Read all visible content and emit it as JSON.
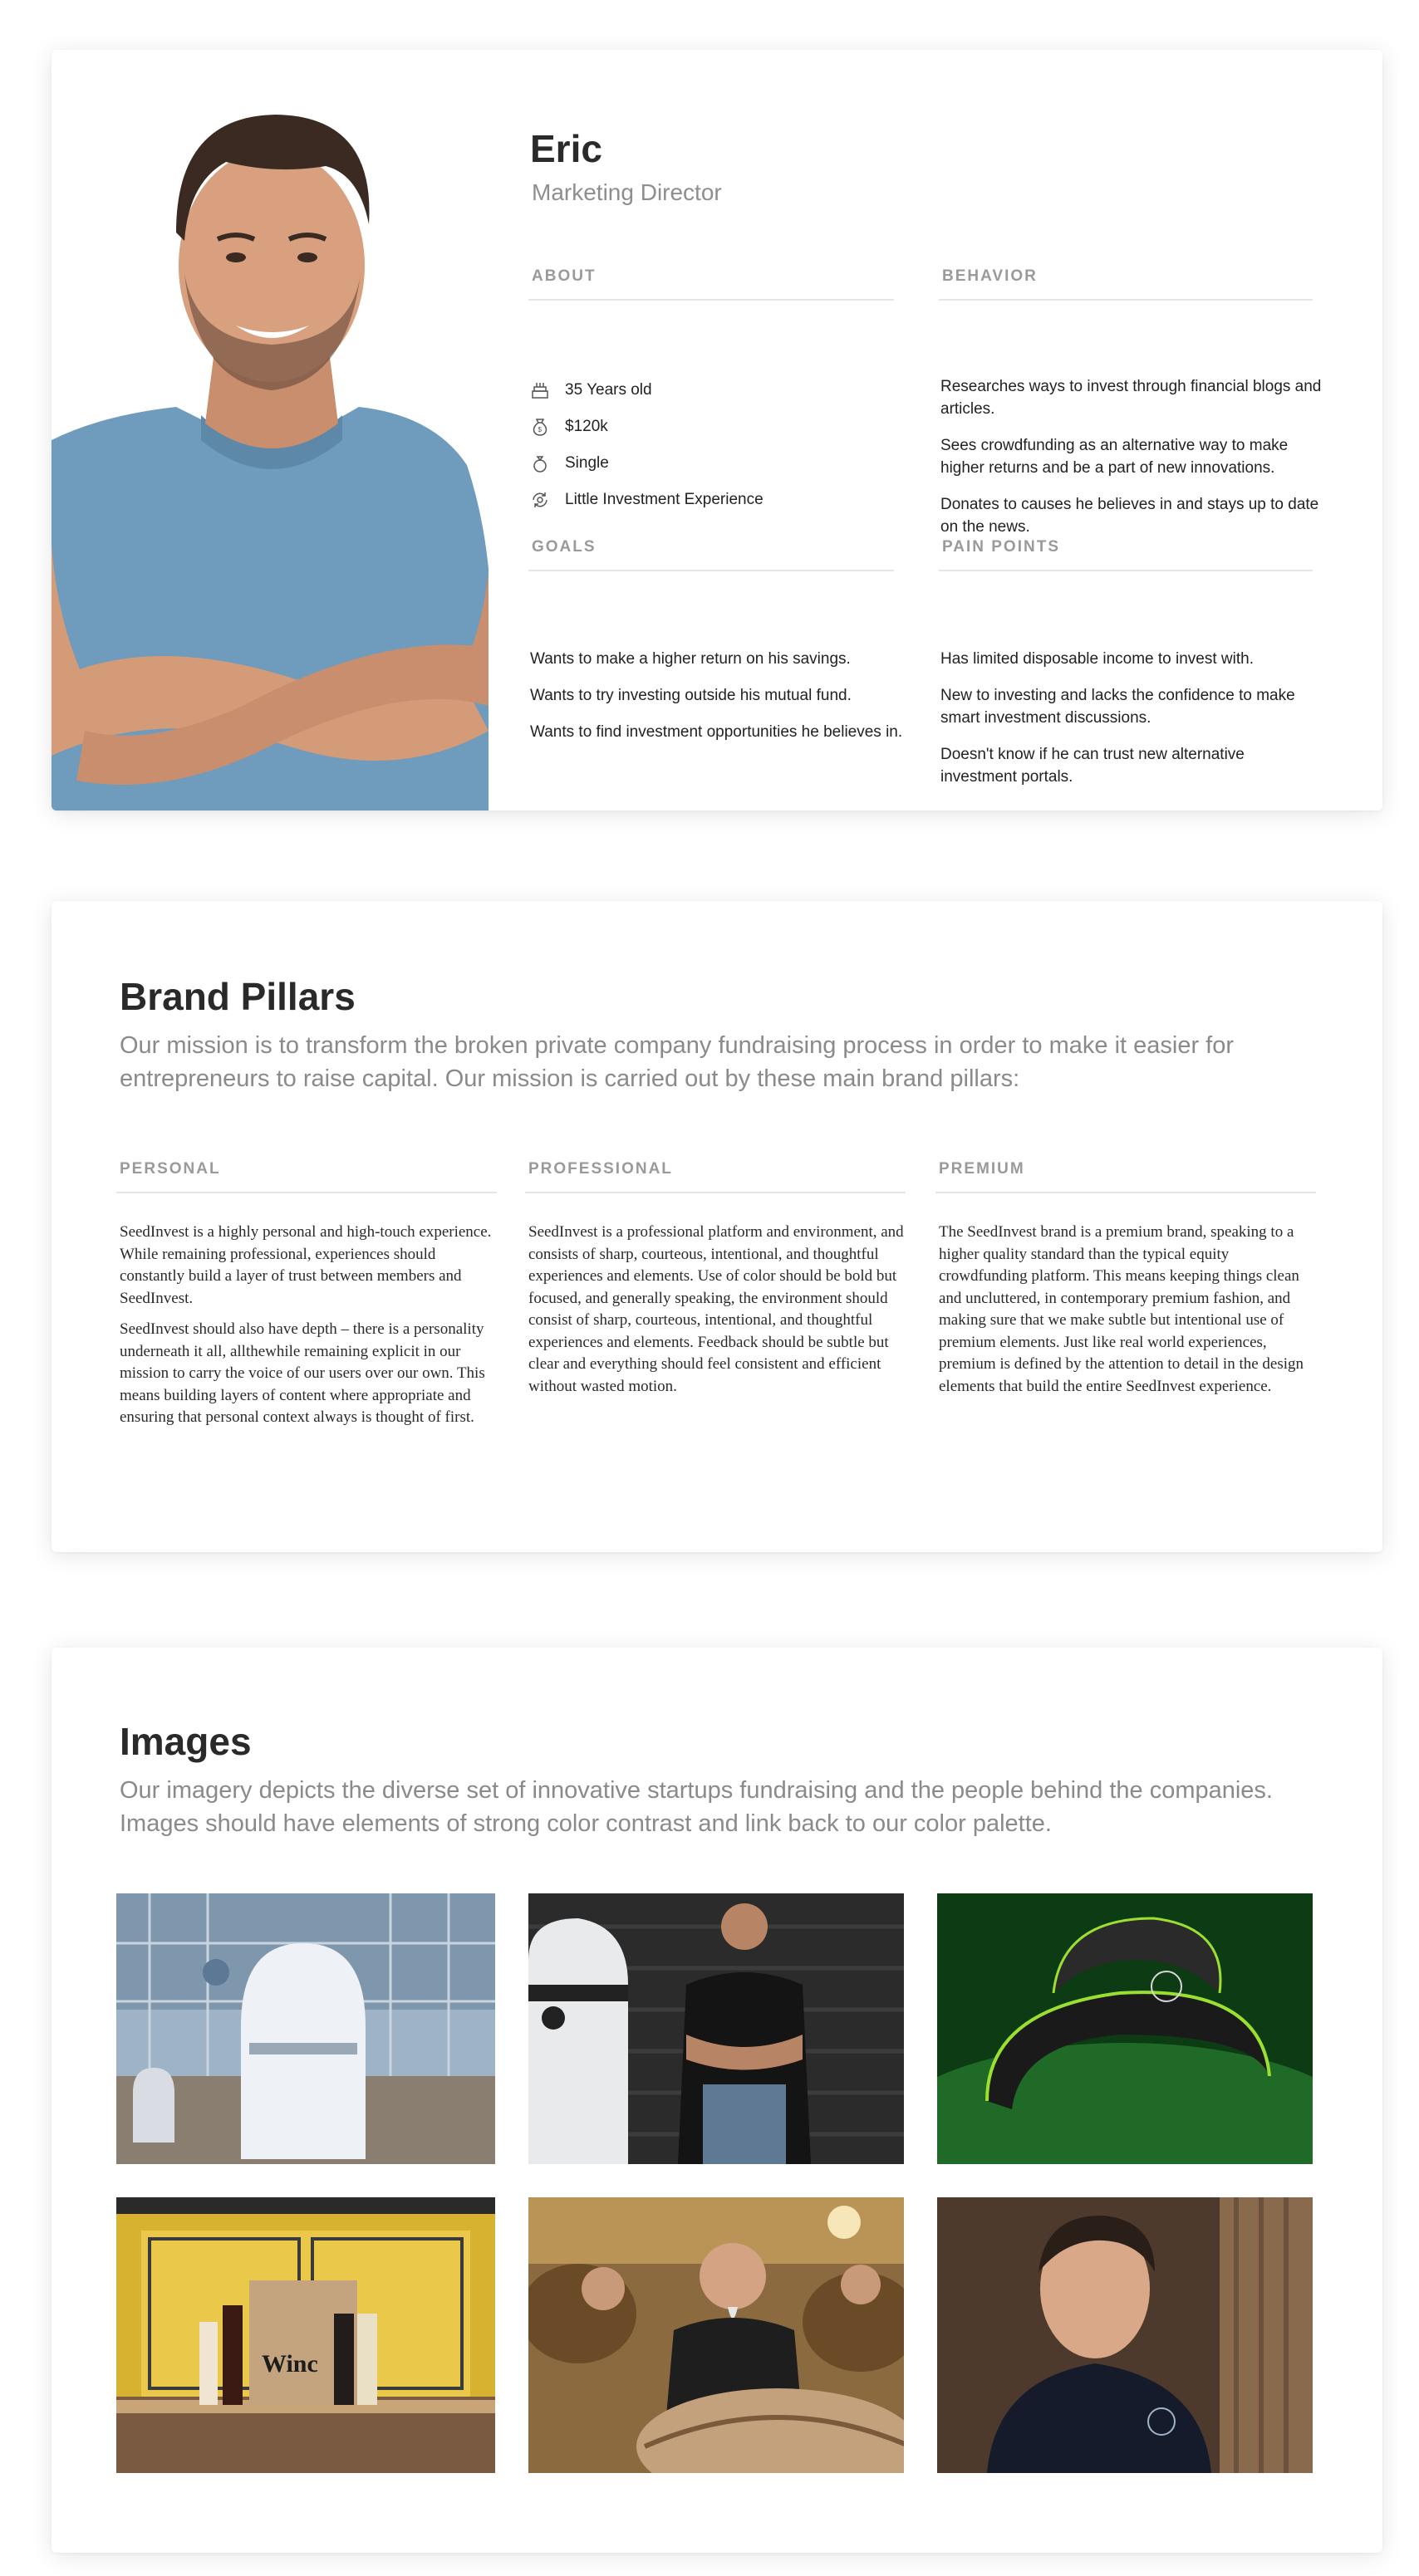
{
  "persona": {
    "name": "Eric",
    "role": "Marketing Director",
    "about": {
      "label": "ABOUT",
      "items": [
        {
          "icon": "birthday-cake-icon",
          "text": "35 Years old"
        },
        {
          "icon": "money-bag-icon",
          "text": "$120k"
        },
        {
          "icon": "ring-icon",
          "text": "Single"
        },
        {
          "icon": "investment-cycle-icon",
          "text": "Little Investment Experience"
        }
      ]
    },
    "behavior": {
      "label": "BEHAVIOR",
      "items": [
        "Researches ways to invest through financial blogs and articles.",
        "Sees crowdfunding as an alternative way to make higher returns and be a part of new innovations.",
        "Donates to causes he believes in and stays up to date on the news."
      ]
    },
    "goals": {
      "label": "GOALS",
      "items": [
        "Wants to make a higher return on his savings.",
        "Wants to try investing outside his mutual fund.",
        "Wants to find investment opportunities he believes in."
      ]
    },
    "pain_points": {
      "label": "PAIN POINTS",
      "items": [
        "Has limited disposable income to invest with.",
        "New to investing and lacks the confidence to make smart investment discussions.",
        "Doesn't know if he can trust new alternative investment portals."
      ]
    }
  },
  "brand_pillars": {
    "title": "Brand Pillars",
    "description": "Our mission is to transform the broken private company fundraising process in order to make it easier for entrepreneurs to raise capital. Our mission is carried out by these main brand pillars:",
    "pillars": [
      {
        "label": "PERSONAL",
        "paragraphs": [
          "SeedInvest is a highly personal and high-touch experience. While remaining professional, experiences should constantly build a layer of trust between members and SeedInvest.",
          "SeedInvest should also have depth – there is a personality underneath it all, allthewhile remaining explicit in our mission to carry the voice of our users over our own. This means building layers of content where appropriate and ensuring that personal context always is thought of first."
        ]
      },
      {
        "label": "PROFESSIONAL",
        "paragraphs": [
          "SeedInvest is a professional platform and environment, and consists of sharp, courteous, intentional, and thoughtful experiences and elements. Use of color should be bold but focused, and generally speaking, the environment should consist of sharp, courteous, intentional, and thoughtful experiences and elements. Feedback should be subtle but clear and everything should feel consistent and efficient without wasted motion."
        ]
      },
      {
        "label": "PREMIUM",
        "paragraphs": [
          "The SeedInvest brand is a premium brand, speaking to a higher quality standard than the typical equity crowdfunding platform. This means keeping things clean and uncluttered, in contemporary premium fashion, and making sure that we make subtle but intentional use of premium elements. Just like real world experiences, premium is defined by the attention to detail in the design elements that build the entire SeedInvest experience."
        ]
      }
    ]
  },
  "images_section": {
    "title": "Images",
    "description": "Our imagery depicts the diverse set of innovative startups fundraising and the people behind the companies. Images should have elements of strong color contrast and link back to our color palette.",
    "bottle_label": "Winc"
  },
  "colors": {
    "heading": "#2a2a2a",
    "muted": "#8a8a8a",
    "label": "#9a9a9a",
    "rule": "#e6e6e6",
    "shirt_blue": "#6f9bbd"
  }
}
